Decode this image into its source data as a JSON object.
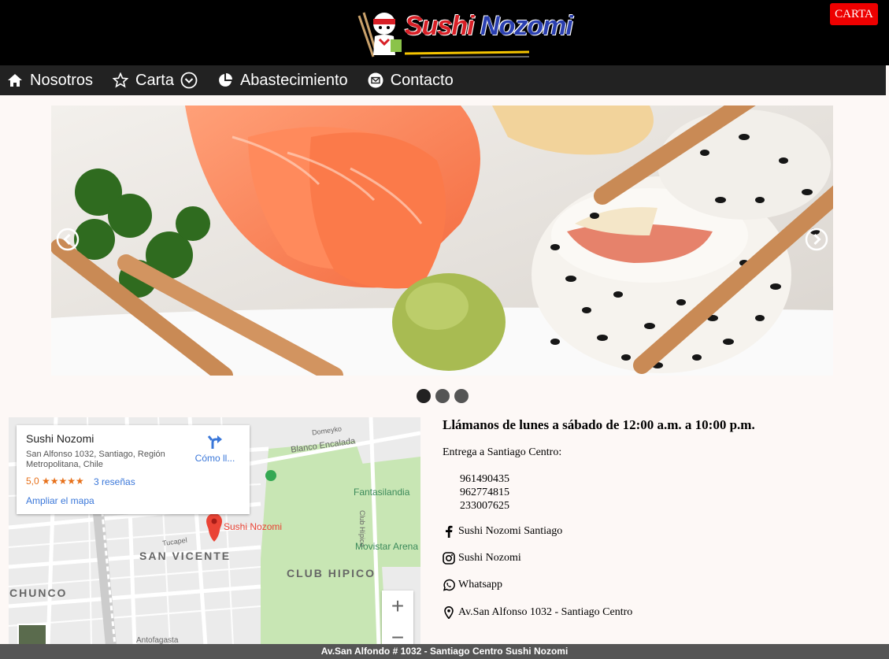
{
  "header": {
    "logo_text_red": "Sushi",
    "logo_text_blue": "Nozomi",
    "carta_button": "CARTA"
  },
  "nav": {
    "items": [
      {
        "label": "Nosotros",
        "icon": "home-icon"
      },
      {
        "label": "Carta",
        "icon": "star-icon",
        "has_dropdown": true
      },
      {
        "label": "Abastecimiento",
        "icon": "pie-chart-icon"
      },
      {
        "label": "Contacto",
        "icon": "envelope-icon"
      }
    ]
  },
  "slider": {
    "slide_count": 3,
    "active_index": 0
  },
  "map": {
    "place_name": "Sushi Nozomi",
    "address": "San Alfonso 1032, Santiago, Región Metropolitana, Chile",
    "rating": "5,0 ★★★★★",
    "reviews": "3 reseñas",
    "enlarge_link": "Ampliar el mapa",
    "directions": "Cómo ll...",
    "pin_label": "Sushi Nozomi",
    "labels": {
      "san_vicente": "SAN VICENTE",
      "club_hipico": "CLUB HIPICO",
      "chunco": "CHUNCO",
      "blanco_encalada": "Blanco Encalada",
      "fantasilandia": "Fantasilandia",
      "movistar": "Movistar Arena",
      "domeyko": "Domeyko",
      "tucapel": "Tucapel",
      "antofagasta": "Antofagasta",
      "club_hipico_st": "Club Hípico"
    },
    "zoom_in": "+",
    "zoom_out": "−"
  },
  "contact": {
    "heading": "Llámanos de lunes a sábado de 12:00 a.m. a 10:00 p.m.",
    "delivery": "Entrega a Santiago Centro:",
    "phones": [
      "961490435",
      "962774815",
      "233007625"
    ],
    "facebook": "Sushi Nozomi Santiago",
    "instagram": "Sushi Nozomi",
    "whatsapp": "Whatsapp",
    "address": "Av.San Alfonso 1032 - Santiago Centro"
  },
  "footer": {
    "text": "Av.San Alfondo # 1032 - Santiago Centro Sushi Nozomi"
  }
}
